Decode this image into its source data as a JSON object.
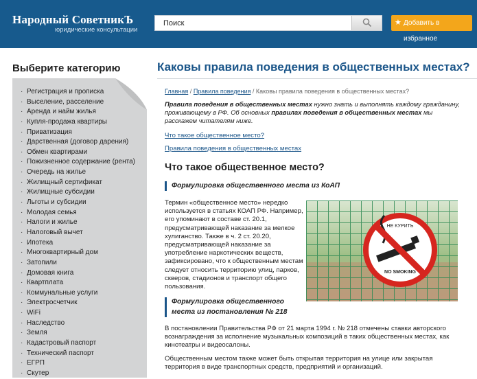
{
  "header": {
    "logo_title": "Народный СоветникЪ",
    "logo_subtitle": "юридические консультации",
    "search_placeholder": "Поиск",
    "favorite_label": "Добавить в избранное"
  },
  "colors": {
    "header_bg": "#175a8d",
    "accent": "#f3a61b",
    "link": "#1a5589",
    "sidebar_bg": "#d3d4d5"
  },
  "sidebar": {
    "title": "Выберите категорию",
    "items": [
      "Регистрация и прописка",
      "Выселение, расселение",
      "Аренда и найм жилья",
      "Купля-продажа квартиры",
      "Приватизация",
      "Дарственная (договор дарения)",
      "Обмен квартирами",
      "Пожизненное содержание (рента)",
      "Очередь на жилье",
      "Жилищный сертификат",
      "Жилищные субсидии",
      "Льготы и субсидии",
      "Молодая семья",
      "Налоги и жилье",
      "Налоговый вычет",
      "Ипотека",
      "Многоквартирный дом",
      "Затопили",
      "Домовая книга",
      "Квартплата",
      "Коммунальные услуги",
      "Электросчетчик",
      "WiFi",
      "Наследство",
      "Земля",
      "Кадастровый паспорт",
      "Технический паспорт",
      "ЕГРП",
      "Скутер"
    ]
  },
  "main": {
    "title": "Каковы правила поведения в общественных местах?",
    "breadcrumb": {
      "home": "Главная",
      "separator": "/",
      "section": "Правила поведения",
      "current": "Каковы правила поведения в общественных местах?"
    },
    "intro": {
      "bold1": "Правила поведения в общественных местах",
      "text1": " нужно знать и выполнять каждому гражданину, проживающему в РФ. Об основных ",
      "bold2": "правилах поведения в общественных местах",
      "text2": " мы расскажем читателям ниже."
    },
    "toc": [
      "Что такое общественное место?",
      "Правила поведения в общественных местах"
    ],
    "h2": "Что такое общественное место?",
    "h3_1": "Формулировка общественного места из КоАП",
    "para1": "Термин «общественное место» нередко используется в статьях КОАП РФ. Например, его упоминают в составе ст. 20.1, предусматривающей наказание за мелкое хулиганство. Также в ч. 2 ст. 20.20, предусматривающей наказание за употребление наркотических веществ, зафиксировано, что к общественным местам следует относить территорию улиц, парков, скверов, стадионов и транспорт общего пользования.",
    "h3_2": "Формулировка общественного места из постановления № 218",
    "para2": "В постановлении Правительства РФ от 21 марта 1994 г. № 218 отмечены ставки авторского вознаграждения за исполнение музыкальных композиций в таких общественных местах, как кинотеатры и видеосалоны.",
    "para3": "Общественным местом также может быть открытая территория на улице или закрытая территория в виде транспортных средств, предприятий и организаций.",
    "photo": {
      "sign_top": "НЕ КУРИТЬ",
      "sign_bottom": "NO SMOKING"
    }
  }
}
